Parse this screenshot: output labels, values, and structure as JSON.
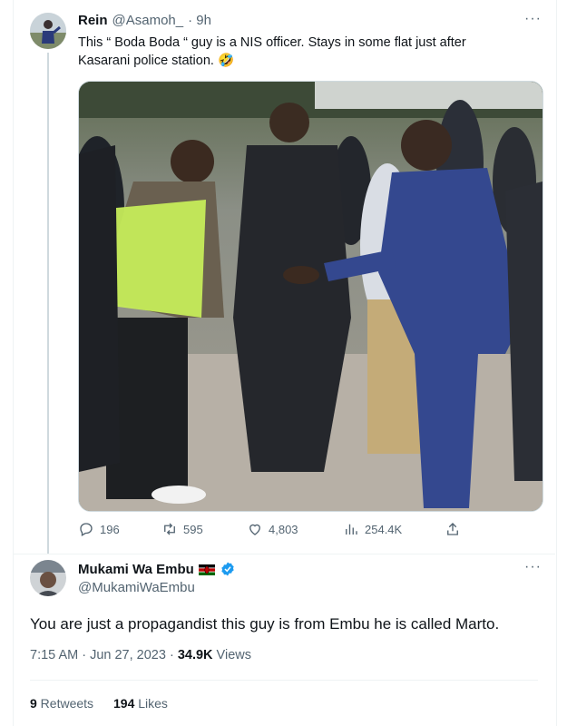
{
  "tweet": {
    "author_name": "Rein",
    "author_handle": "@Asamoh_",
    "time": "· 9h",
    "more_label": "···",
    "text": "This “ Boda Boda “ guy is a NIS officer. Stays in some flat just after Kasarani police station. 🤣",
    "image_alt": "Photo of a man in a reflective vest shaking hands with a man in a blue suit, surrounded by men in suits",
    "actions": {
      "replies": "196",
      "retweets": "595",
      "likes": "4,803",
      "views": "254.4K"
    },
    "icons": [
      "reply-icon",
      "retweet-icon",
      "like-icon",
      "views-icon",
      "share-icon"
    ]
  },
  "reply": {
    "author_name": "Mukami Wa Embu",
    "flag": "🇰🇪",
    "verified": true,
    "author_handle": "@MukamiWaEmbu",
    "more_label": "···",
    "text": "You are just a propagandist this guy is from Embu he is called Marto.",
    "time": "7:15 AM · Jun 27, 2023 · ",
    "views_count": "34.9K",
    "views_label": " Views",
    "retweets_count": "9",
    "retweets_label": " Retweets",
    "likes_count": "194",
    "likes_label": " Likes"
  },
  "colors": {
    "accent": "#1d9bf0",
    "text": "#0f1419",
    "muted": "#536471",
    "border": "#eff3f4",
    "kenya_black": "#000000",
    "kenya_red": "#bb0000",
    "kenya_green": "#006600"
  }
}
